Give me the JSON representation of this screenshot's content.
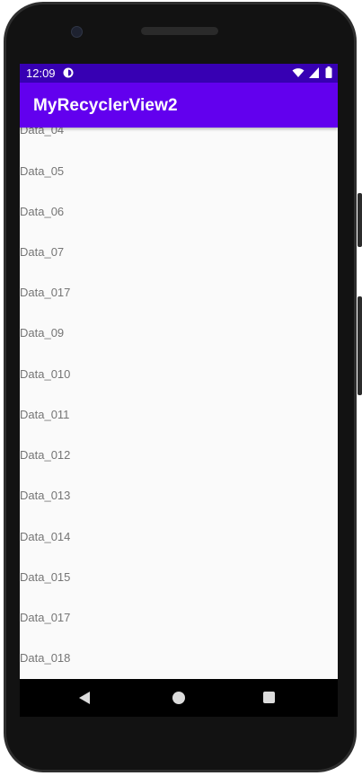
{
  "status_bar": {
    "time": "12:09",
    "app_icon": "circle-half-icon",
    "wifi_icon": "wifi-icon",
    "signal_icon": "signal-icon",
    "battery_icon": "battery-icon"
  },
  "app_bar": {
    "title": "MyRecyclerView2",
    "color": "#6200ee",
    "status_color": "#3700b3"
  },
  "list": {
    "items": [
      {
        "label": "Data_04"
      },
      {
        "label": "Data_05"
      },
      {
        "label": "Data_06"
      },
      {
        "label": "Data_07"
      },
      {
        "label": "Data_017"
      },
      {
        "label": "Data_09"
      },
      {
        "label": "Data_010"
      },
      {
        "label": "Data_011"
      },
      {
        "label": "Data_012"
      },
      {
        "label": "Data_013"
      },
      {
        "label": "Data_014"
      },
      {
        "label": "Data_015"
      },
      {
        "label": "Data_017"
      },
      {
        "label": "Data_018"
      }
    ]
  },
  "nav_bar": {
    "back_icon": "back-triangle-icon",
    "home_icon": "home-circle-icon",
    "recents_icon": "recents-square-icon"
  }
}
